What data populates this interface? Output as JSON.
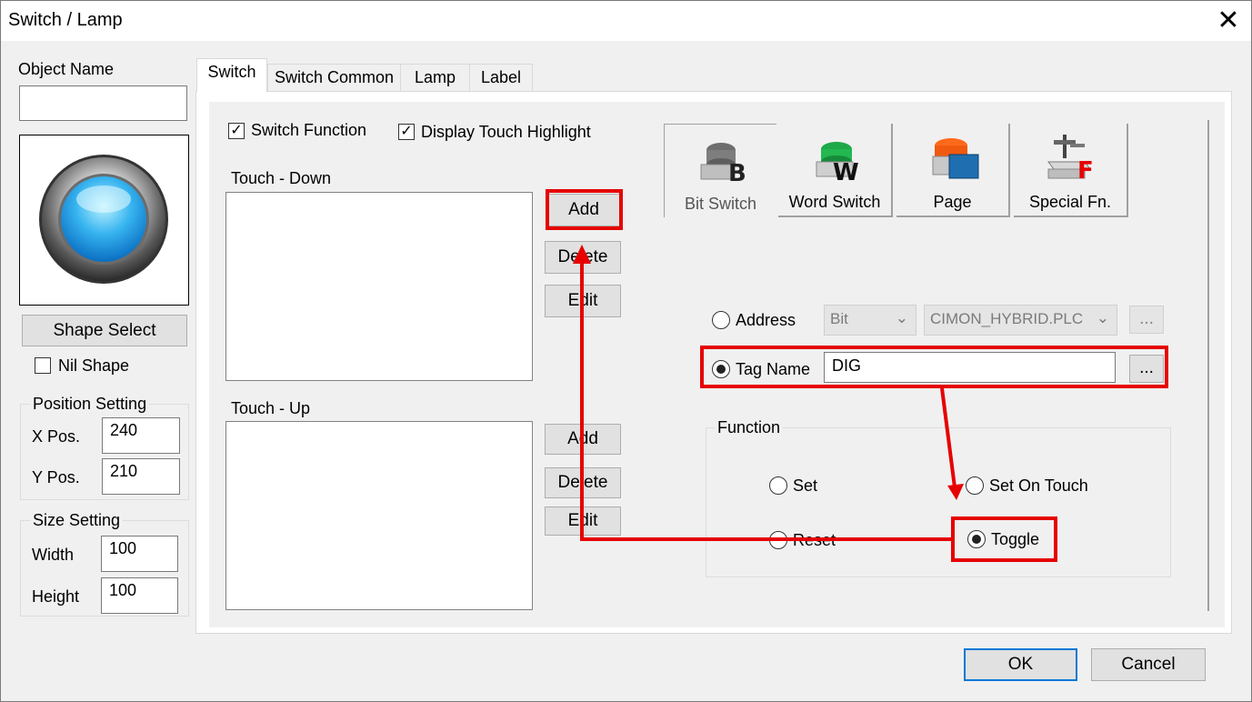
{
  "window": {
    "title": "Switch / Lamp"
  },
  "object_name": {
    "label": "Object Name",
    "value": ""
  },
  "shape": {
    "select_label": "Shape Select",
    "nil_label": "Nil Shape",
    "nil_checked": false
  },
  "position": {
    "group_label": "Position Setting",
    "x_label": "X Pos.",
    "x_value": "240",
    "y_label": "Y Pos.",
    "y_value": "210"
  },
  "size": {
    "group_label": "Size Setting",
    "width_label": "Width",
    "width_value": "100",
    "height_label": "Height",
    "height_value": "100"
  },
  "tabs": [
    {
      "label": "Switch",
      "active": true
    },
    {
      "label": "Switch Common",
      "active": false
    },
    {
      "label": "Lamp",
      "active": false
    },
    {
      "label": "Label",
      "active": false
    }
  ],
  "switch_tab": {
    "switch_function": {
      "label": "Switch Function",
      "checked": true
    },
    "display_highlight": {
      "label": "Display Touch Highlight",
      "checked": true
    },
    "touch_down": {
      "label": "Touch - Down",
      "add": "Add",
      "delete": "Delete",
      "edit": "Edit"
    },
    "touch_up": {
      "label": "Touch - Up",
      "add": "Add",
      "delete": "Delete",
      "edit": "Edit"
    },
    "switch_types": [
      {
        "label": "Bit Switch",
        "icon": "bit-switch-icon",
        "selected": true
      },
      {
        "label": "Word Switch",
        "icon": "word-switch-icon",
        "selected": false
      },
      {
        "label": "Page",
        "icon": "page-switch-icon",
        "selected": false
      },
      {
        "label": "Special Fn.",
        "icon": "special-fn-icon",
        "selected": false
      }
    ],
    "address": {
      "label": "Address",
      "type_value": "Bit",
      "plc_value": "CIMON_HYBRID.PLC",
      "browse": "...",
      "selected": false
    },
    "tag_name": {
      "label": "Tag Name",
      "value": "DIG",
      "browse": "...",
      "selected": true
    },
    "function": {
      "group_label": "Function",
      "options": {
        "set": "Set",
        "set_on_touch": "Set On Touch",
        "reset": "Reset",
        "toggle": "Toggle"
      },
      "selected": "Toggle"
    }
  },
  "footer": {
    "ok": "OK",
    "cancel": "Cancel"
  },
  "annotation_color": "#e60000",
  "accent_color": "#0078d7"
}
